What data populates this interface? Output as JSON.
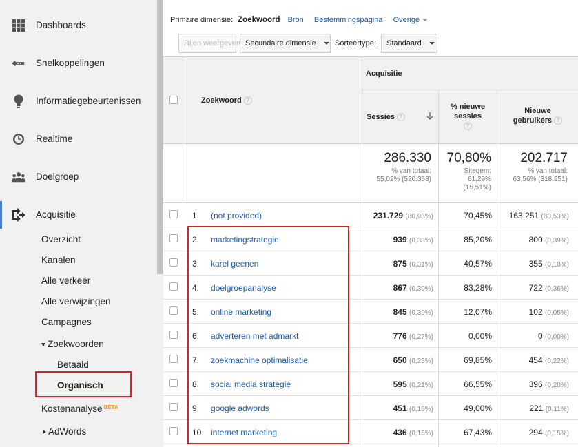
{
  "sidebar": {
    "main_items": [
      {
        "label": "Dashboards",
        "icon": "grid-icon"
      },
      {
        "label": "Snelkoppelingen",
        "icon": "shortcut-arrow-icon"
      },
      {
        "label": "Informatiegebeurtenissen",
        "icon": "lightbulb-icon"
      },
      {
        "label": "Realtime",
        "icon": "clock-icon"
      },
      {
        "label": "Doelgroep",
        "icon": "people-icon"
      },
      {
        "label": "Acquisitie",
        "icon": "acquisition-arrows-icon"
      }
    ],
    "sub_items": [
      "Overzicht",
      "Kanalen",
      "Alle verkeer",
      "Alle verwijzingen",
      "Campagnes"
    ],
    "zoekwoorden": "Zoekwoorden",
    "betaald": "Betaald",
    "organisch": "Organisch",
    "kostenanalyse": "Kostenanalyse",
    "beta": "BÈTA",
    "adwords": "AdWords"
  },
  "toolbar": {
    "primary_label": "Primaire dimensie:",
    "primary_selected": "Zoekwoord",
    "links": [
      "Bron",
      "Bestemmingspagina"
    ],
    "overige": "Overige",
    "rows_button": "Rijen weergeven",
    "secondary_dim": "Secundaire dimensie",
    "sort_label": "Sorteertype:",
    "sort_value": "Standaard"
  },
  "table": {
    "col_keyword": "Zoekwoord",
    "group_header": "Acquisitie",
    "col_sessions": "Sessies",
    "col_new_pct": "% nieuwe sessies",
    "col_new_users": "Nieuwe gebruikers",
    "totals": {
      "sessions": "286.330",
      "sessions_sub": [
        "% van totaal:",
        "55,02% (520.368)"
      ],
      "new_pct": "70,80%",
      "new_pct_sub": [
        "Sitegem:",
        "61,29%",
        "(15,51%)"
      ],
      "new_users": "202.717",
      "new_users_sub": [
        "% van totaal:",
        "63,56% (318.951)"
      ]
    },
    "rows": [
      {
        "idx": "1.",
        "keyword": "(not provided)",
        "sessions": "231.729",
        "sessions_pct": "(80,93%)",
        "new_pct": "70,45%",
        "new_users": "163.251",
        "new_users_pct": "(80,53%)"
      },
      {
        "idx": "2.",
        "keyword": "marketingstrategie",
        "sessions": "939",
        "sessions_pct": "(0,33%)",
        "new_pct": "85,20%",
        "new_users": "800",
        "new_users_pct": "(0,39%)"
      },
      {
        "idx": "3.",
        "keyword": "karel geenen",
        "sessions": "875",
        "sessions_pct": "(0,31%)",
        "new_pct": "40,57%",
        "new_users": "355",
        "new_users_pct": "(0,18%)"
      },
      {
        "idx": "4.",
        "keyword": "doelgroepanalyse",
        "sessions": "867",
        "sessions_pct": "(0,30%)",
        "new_pct": "83,28%",
        "new_users": "722",
        "new_users_pct": "(0,36%)"
      },
      {
        "idx": "5.",
        "keyword": "online marketing",
        "sessions": "845",
        "sessions_pct": "(0,30%)",
        "new_pct": "12,07%",
        "new_users": "102",
        "new_users_pct": "(0,05%)"
      },
      {
        "idx": "6.",
        "keyword": "adverteren met admarkt",
        "sessions": "776",
        "sessions_pct": "(0,27%)",
        "new_pct": "0,00%",
        "new_users": "0",
        "new_users_pct": "(0,00%)"
      },
      {
        "idx": "7.",
        "keyword": "zoekmachine optimalisatie",
        "sessions": "650",
        "sessions_pct": "(0,23%)",
        "new_pct": "69,85%",
        "new_users": "454",
        "new_users_pct": "(0,22%)"
      },
      {
        "idx": "8.",
        "keyword": "social media strategie",
        "sessions": "595",
        "sessions_pct": "(0,21%)",
        "new_pct": "66,55%",
        "new_users": "396",
        "new_users_pct": "(0,20%)"
      },
      {
        "idx": "9.",
        "keyword": "google adwords",
        "sessions": "451",
        "sessions_pct": "(0,16%)",
        "new_pct": "49,00%",
        "new_users": "221",
        "new_users_pct": "(0,11%)"
      },
      {
        "idx": "10.",
        "keyword": "internet marketing",
        "sessions": "436",
        "sessions_pct": "(0,15%)",
        "new_pct": "67,43%",
        "new_users": "294",
        "new_users_pct": "(0,15%)"
      }
    ]
  },
  "colors": {
    "link": "#1a5aa7",
    "highlight": "#d0262e",
    "active_bar": "#4a7fd0"
  }
}
